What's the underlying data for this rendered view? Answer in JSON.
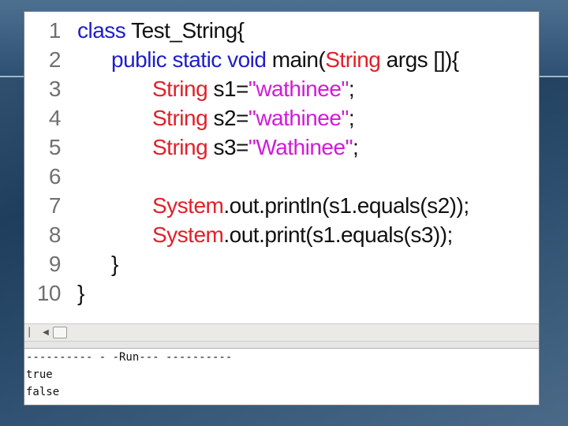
{
  "editor": {
    "lines": [
      {
        "num": "1",
        "tokens": [
          [
            "kw",
            "class "
          ],
          [
            "plain",
            "Test_String{"
          ]
        ]
      },
      {
        "num": "2",
        "tokens": [
          [
            "kw",
            "public static void "
          ],
          [
            "plain",
            "main("
          ],
          [
            "type",
            "String"
          ],
          [
            "plain",
            " args []){"
          ]
        ]
      },
      {
        "num": "3",
        "tokens": [
          [
            "type",
            "String "
          ],
          [
            "plain",
            "s1="
          ],
          [
            "str",
            "\"wathinee\""
          ],
          [
            "plain",
            ";"
          ]
        ]
      },
      {
        "num": "4",
        "tokens": [
          [
            "type",
            "String "
          ],
          [
            "plain",
            "s2="
          ],
          [
            "str",
            "\"wathinee\""
          ],
          [
            "plain",
            ";"
          ]
        ]
      },
      {
        "num": "5",
        "tokens": [
          [
            "type",
            "String "
          ],
          [
            "plain",
            "s3="
          ],
          [
            "str",
            "\"Wathinee\""
          ],
          [
            "plain",
            ";"
          ]
        ]
      },
      {
        "num": "6",
        "tokens": []
      },
      {
        "num": "7",
        "tokens": [
          [
            "type",
            "System"
          ],
          [
            "plain",
            ".out.println(s1.equals(s2));"
          ]
        ]
      },
      {
        "num": "8",
        "tokens": [
          [
            "type",
            "System"
          ],
          [
            "plain",
            ".out.print(s1.equals(s3));"
          ]
        ]
      },
      {
        "num": "9",
        "tokens": [
          [
            "plain",
            "}"
          ]
        ]
      },
      {
        "num": "10",
        "tokens": [
          [
            "plain",
            "}"
          ]
        ]
      }
    ]
  },
  "output": {
    "header": "---------- - -Run--- ----------",
    "lines": [
      "true",
      "false"
    ]
  }
}
